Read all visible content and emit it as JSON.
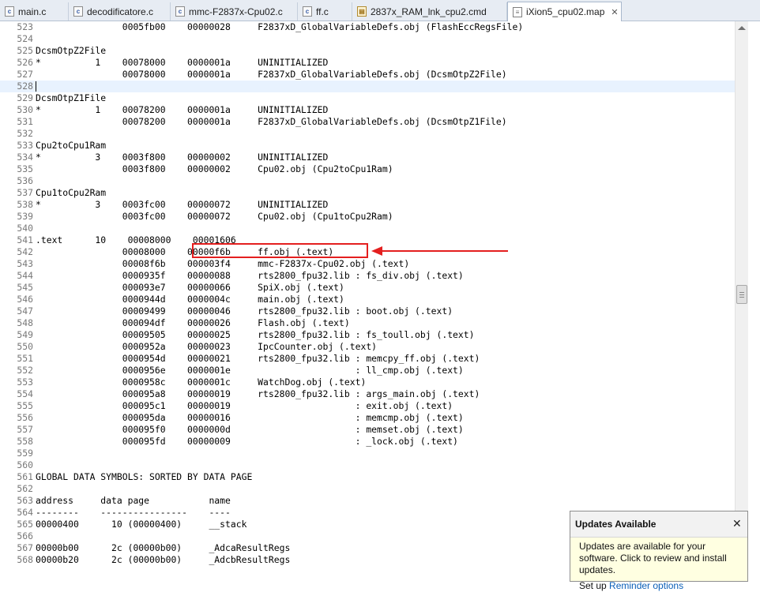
{
  "tabs": [
    {
      "label": "main.c",
      "icon": "c-file-icon"
    },
    {
      "label": "decodificatore.c",
      "icon": "c-file-icon"
    },
    {
      "label": "mmc-F2837x-Cpu02.c",
      "icon": "c-file-icon"
    },
    {
      "label": "ff.c",
      "icon": "c-file-icon"
    },
    {
      "label": "2837x_RAM_lnk_cpu2.cmd",
      "icon": "cmd-file-icon"
    },
    {
      "label": "iXion5_cpu02.map",
      "icon": "map-file-icon",
      "active": true,
      "close": "✕"
    }
  ],
  "editor": {
    "current_line": "528",
    "lines": [
      {
        "num": "523",
        "text": "                0005fb00    00000028     F2837xD_GlobalVariableDefs.obj (FlashEccRegsFile)"
      },
      {
        "num": "524",
        "text": ""
      },
      {
        "num": "525",
        "text": "DcsmOtpZ2File"
      },
      {
        "num": "526",
        "text": "*          1    00078000    0000001a     UNINITIALIZED"
      },
      {
        "num": "527",
        "text": "                00078000    0000001a     F2837xD_GlobalVariableDefs.obj (DcsmOtpZ2File)"
      },
      {
        "num": "528",
        "text": ""
      },
      {
        "num": "529",
        "text": "DcsmOtpZ1File"
      },
      {
        "num": "530",
        "text": "*          1    00078200    0000001a     UNINITIALIZED"
      },
      {
        "num": "531",
        "text": "                00078200    0000001a     F2837xD_GlobalVariableDefs.obj (DcsmOtpZ1File)"
      },
      {
        "num": "532",
        "text": ""
      },
      {
        "num": "533",
        "text": "Cpu2toCpu1Ram"
      },
      {
        "num": "534",
        "text": "*          3    0003f800    00000002     UNINITIALIZED"
      },
      {
        "num": "535",
        "text": "                0003f800    00000002     Cpu02.obj (Cpu2toCpu1Ram)"
      },
      {
        "num": "536",
        "text": ""
      },
      {
        "num": "537",
        "text": "Cpu1toCpu2Ram"
      },
      {
        "num": "538",
        "text": "*          3    0003fc00    00000072     UNINITIALIZED"
      },
      {
        "num": "539",
        "text": "                0003fc00    00000072     Cpu02.obj (Cpu1toCpu2Ram)"
      },
      {
        "num": "540",
        "text": ""
      },
      {
        "num": "541",
        "text": ".text      10    00008000    00001606"
      },
      {
        "num": "542",
        "text": "                00008000    00000f6b     ff.obj (.text)"
      },
      {
        "num": "543",
        "text": "                00008f6b    000003f4     mmc-F2837x-Cpu02.obj (.text)"
      },
      {
        "num": "544",
        "text": "                0000935f    00000088     rts2800_fpu32.lib : fs_div.obj (.text)"
      },
      {
        "num": "545",
        "text": "                000093e7    00000066     SpiX.obj (.text)"
      },
      {
        "num": "546",
        "text": "                0000944d    0000004c     main.obj (.text)"
      },
      {
        "num": "547",
        "text": "                00009499    00000046     rts2800_fpu32.lib : boot.obj (.text)"
      },
      {
        "num": "548",
        "text": "                000094df    00000026     Flash.obj (.text)"
      },
      {
        "num": "549",
        "text": "                00009505    00000025     rts2800_fpu32.lib : fs_toull.obj (.text)"
      },
      {
        "num": "550",
        "text": "                0000952a    00000023     IpcCounter.obj (.text)"
      },
      {
        "num": "551",
        "text": "                0000954d    00000021     rts2800_fpu32.lib : memcpy_ff.obj (.text)"
      },
      {
        "num": "552",
        "text": "                0000956e    0000001e                       : ll_cmp.obj (.text)"
      },
      {
        "num": "553",
        "text": "                0000958c    0000001c     WatchDog.obj (.text)"
      },
      {
        "num": "554",
        "text": "                000095a8    00000019     rts2800_fpu32.lib : args_main.obj (.text)"
      },
      {
        "num": "555",
        "text": "                000095c1    00000019                       : exit.obj (.text)"
      },
      {
        "num": "556",
        "text": "                000095da    00000016                       : memcmp.obj (.text)"
      },
      {
        "num": "557",
        "text": "                000095f0    0000000d                       : memset.obj (.text)"
      },
      {
        "num": "558",
        "text": "                000095fd    00000009                       : _lock.obj (.text)"
      },
      {
        "num": "559",
        "text": ""
      },
      {
        "num": "560",
        "text": ""
      },
      {
        "num": "561",
        "text": "GLOBAL DATA SYMBOLS: SORTED BY DATA PAGE"
      },
      {
        "num": "562",
        "text": ""
      },
      {
        "num": "563",
        "text": "address     data page           name"
      },
      {
        "num": "564",
        "text": "--------    ----------------    ----"
      },
      {
        "num": "565",
        "text": "00000400      10 (00000400)     __stack"
      },
      {
        "num": "566",
        "text": ""
      },
      {
        "num": "567",
        "text": "00000b00      2c (00000b00)     _AdcaResultRegs"
      },
      {
        "num": "568",
        "text": "00000b20      2c (00000b00)     _AdcbResultRegs"
      }
    ]
  },
  "annotation": {
    "highlighted_entry": "00000f6b     ff.obj (.text)",
    "color": "#e41f1f"
  },
  "popup": {
    "title": "Updates Available",
    "close": "✕",
    "message": "Updates are available for your software. Click to review and install updates.",
    "reminder_prefix": "Set up ",
    "reminder_link": "Reminder options"
  }
}
